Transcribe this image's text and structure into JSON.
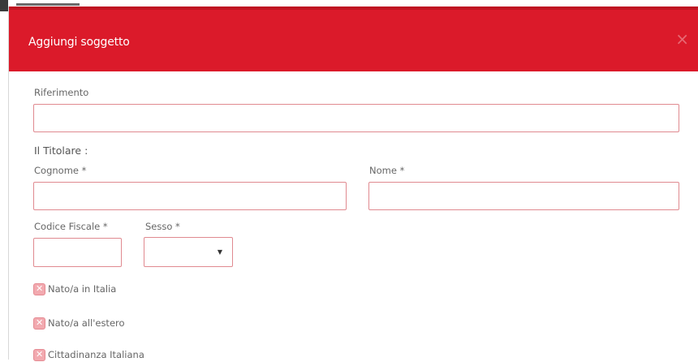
{
  "modal": {
    "title": "Aggiungi soggetto",
    "close_icon": "close-icon"
  },
  "form": {
    "riferimento_label": "Riferimento",
    "riferimento_value": "",
    "titolare_heading": "Il Titolare :",
    "cognome_label": "Cognome *",
    "cognome_value": "",
    "nome_label": "Nome *",
    "nome_value": "",
    "codice_fiscale_label": "Codice Fiscale *",
    "codice_fiscale_value": "",
    "sesso_label": "Sesso *",
    "sesso_selected": "",
    "checkboxes": [
      {
        "label": "Nato/a in Italia",
        "icon": "checkbox-icon"
      },
      {
        "label": "Nato/a all'estero",
        "icon": "checkbox-icon"
      },
      {
        "label": "Cittadinanza Italiana",
        "icon": "checkbox-icon"
      }
    ]
  },
  "colors": {
    "header": "#db1a2a",
    "field_border": "#e08a90",
    "checkbox": "#f2a9af"
  }
}
